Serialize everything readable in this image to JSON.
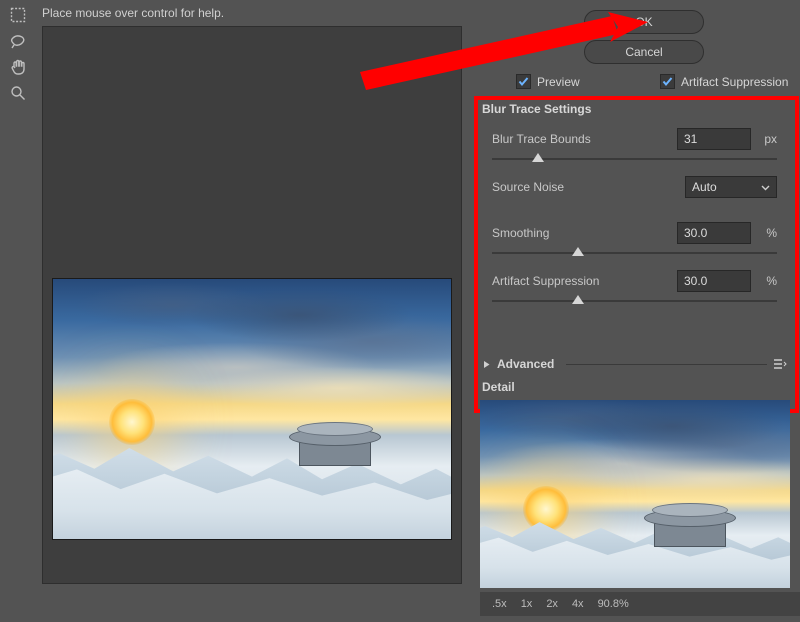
{
  "hint": "Place mouse over control for help.",
  "buttons": {
    "ok": "OK",
    "cancel": "Cancel"
  },
  "checks": {
    "preview": "Preview",
    "artifact": "Artifact Suppression"
  },
  "panel": {
    "title": "Blur Trace Settings",
    "bounds": {
      "label": "Blur Trace Bounds",
      "value": "31",
      "unit": "px",
      "pos": 16
    },
    "noise": {
      "label": "Source Noise",
      "value": "Auto"
    },
    "smooth": {
      "label": "Smoothing",
      "value": "30.0",
      "unit": "%",
      "pos": 30
    },
    "art": {
      "label": "Artifact Suppression",
      "value": "30.0",
      "unit": "%",
      "pos": 30
    }
  },
  "advanced": "Advanced",
  "detail": "Detail",
  "zoom": {
    "a": ".5x",
    "b": "1x",
    "c": "2x",
    "d": "4x",
    "pct": "90.8%"
  }
}
